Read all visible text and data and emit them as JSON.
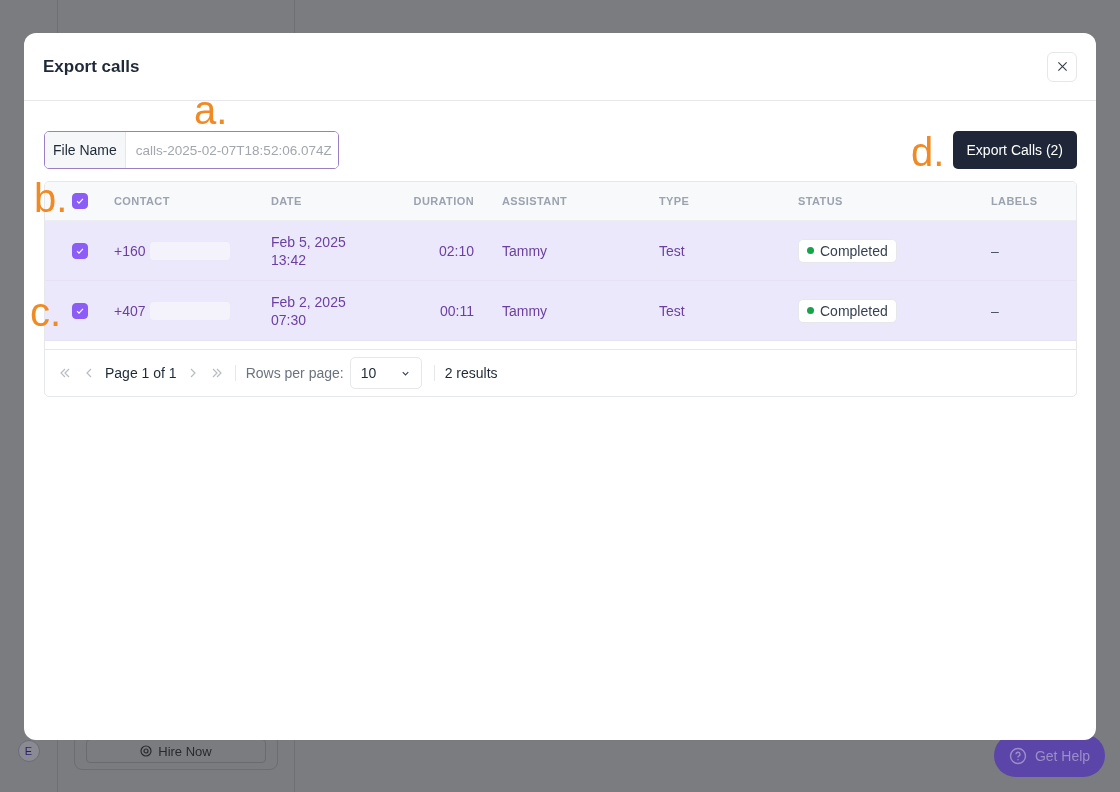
{
  "background": {
    "avatar": "E",
    "hire_button": "Hire Now",
    "help_button": "Get Help"
  },
  "dialog": {
    "title": "Export calls"
  },
  "file_name": {
    "label": "File Name",
    "placeholder": "calls-2025-02-07T18:52:06.074Z"
  },
  "export_button": "Export Calls (2)",
  "table": {
    "select_all": {
      "checked": true
    },
    "columns": [
      "CONTACT",
      "DATE",
      "DURATION",
      "ASSISTANT",
      "TYPE",
      "STATUS",
      "LABELS"
    ],
    "rows": [
      {
        "selected": true,
        "contact": "+160",
        "date": "Feb 5, 2025",
        "time": "13:42",
        "duration": "02:10",
        "assistant": "Tammy",
        "type": "Test",
        "status": "Completed",
        "labels": "–"
      },
      {
        "selected": true,
        "contact": "+407",
        "date": "Feb 2, 2025",
        "time": "07:30",
        "duration": "00:11",
        "assistant": "Tammy",
        "type": "Test",
        "status": "Completed",
        "labels": "–"
      }
    ]
  },
  "pagination": {
    "page": "Page 1 of 1",
    "rows_per_page_label": "Rows per page:",
    "rows_per_page": "10",
    "results": "2 results"
  },
  "annotations": [
    {
      "label": "a."
    },
    {
      "label": "b."
    },
    {
      "label": "c."
    },
    {
      "label": "d."
    }
  ]
}
